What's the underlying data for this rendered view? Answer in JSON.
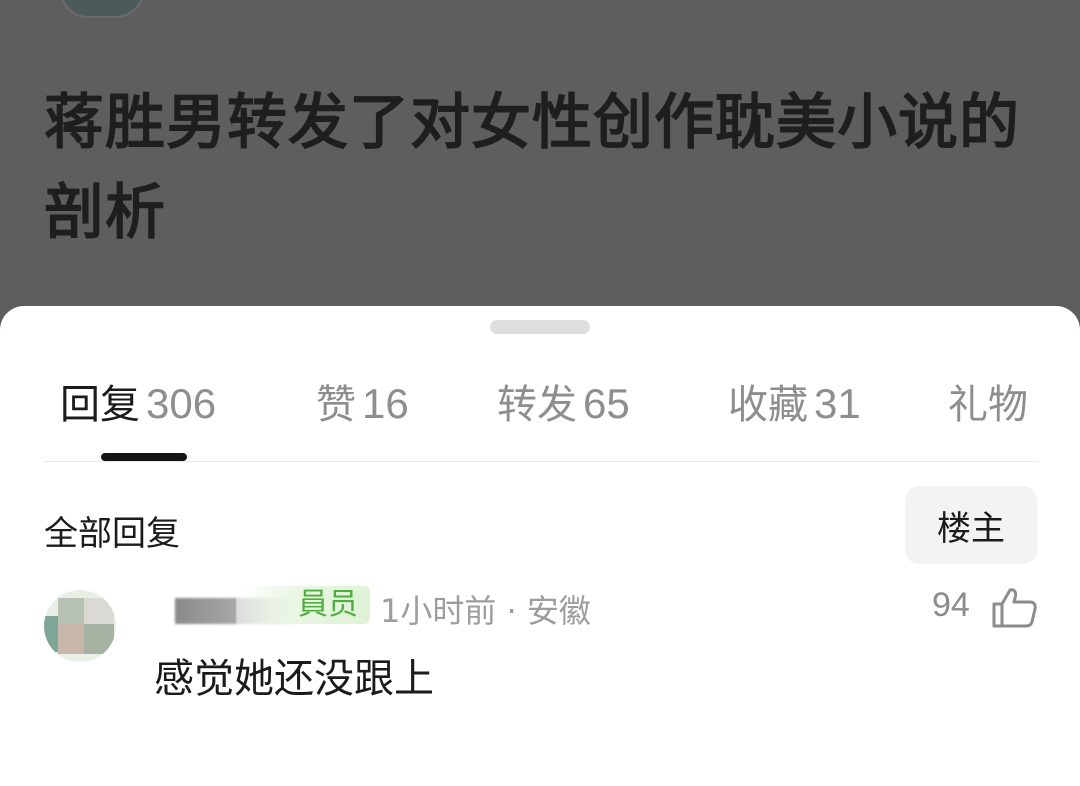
{
  "post": {
    "title": "蒋胜男转发了对女性创作耽美小说的剖析"
  },
  "tabs": [
    {
      "label": "回复",
      "count": "306"
    },
    {
      "label": "赞",
      "count": "16"
    },
    {
      "label": "转发",
      "count": "65"
    },
    {
      "label": "收藏",
      "count": "31"
    },
    {
      "label": "礼物",
      "count": ""
    }
  ],
  "section": {
    "title": "全部回复",
    "op_button": "楼主"
  },
  "comment": {
    "badge": "員员",
    "meta": "1小时前 · 安徽",
    "likes": "94",
    "text": "感觉她还没跟上"
  },
  "icons": {
    "like": "thumbs-up-icon"
  },
  "colors": {
    "badge_text": "#4fae3e",
    "badge_bg": "#dff2d6",
    "overlay": "#5e5e5e"
  }
}
